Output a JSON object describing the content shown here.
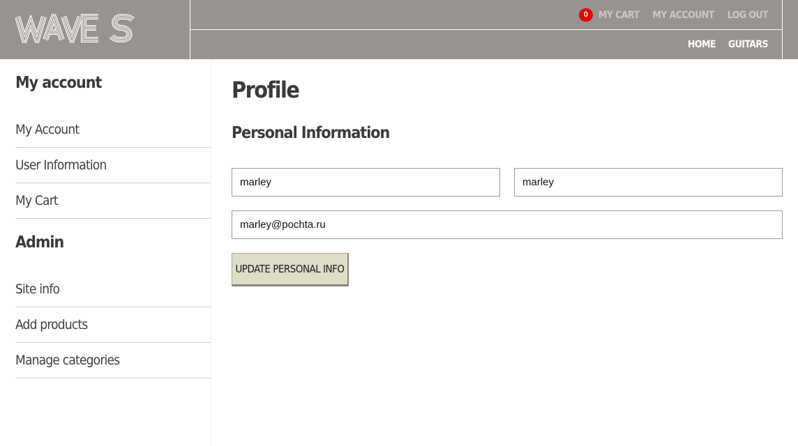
{
  "header": {
    "logo_text": "WAVES",
    "cart_count": "0",
    "top_nav": {
      "cart_label": "MY CART",
      "account_label": "MY ACCOUNT",
      "logout_label": "LOG OUT"
    },
    "main_nav": {
      "home_label": "HOME",
      "guitars_label": "GUITARS"
    },
    "colors": {
      "background": "#979390",
      "badge": "#e00000"
    }
  },
  "sidebar": {
    "account_title": "My account",
    "account_items": [
      {
        "label": "My Account"
      },
      {
        "label": "User Information"
      },
      {
        "label": "My Cart"
      }
    ],
    "admin_title": "Admin",
    "admin_items": [
      {
        "label": "Site info"
      },
      {
        "label": "Add products"
      },
      {
        "label": "Manage categories"
      }
    ]
  },
  "main": {
    "title": "Profile",
    "section_title": "Personal Information",
    "form": {
      "first_name_value": "marley",
      "last_name_value": "marley",
      "email_value": "marley@pochta.ru",
      "submit_label": "UPDATE PERSONAL INFO",
      "button_color": "#dfdcc8"
    }
  }
}
